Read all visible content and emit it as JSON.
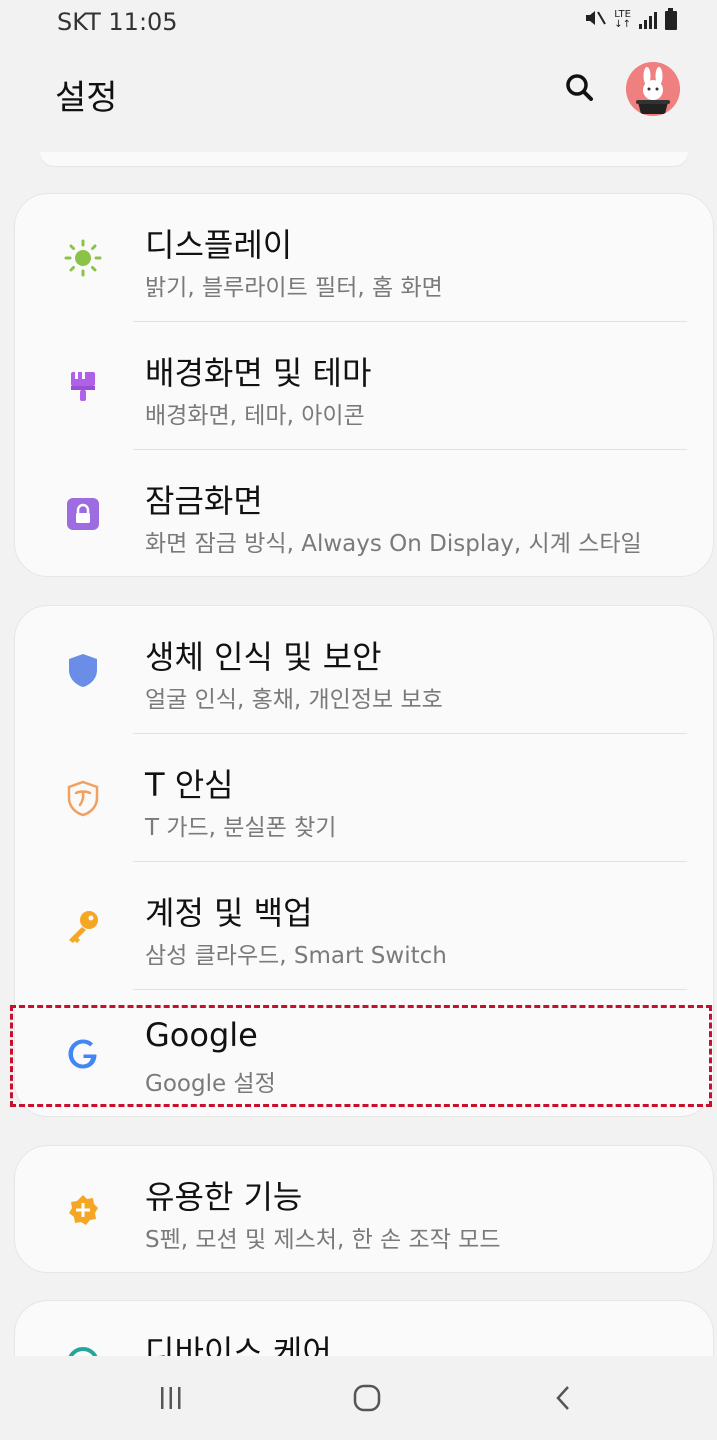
{
  "status_bar": {
    "left_text": "SKT 11:05",
    "network": "LTE",
    "icons": [
      "mute-icon",
      "lte-icon",
      "signal-icon",
      "battery-icon"
    ]
  },
  "header": {
    "title": "설정",
    "icons": [
      "search-icon",
      "avatar"
    ]
  },
  "groups": [
    {
      "items": [
        {
          "title": "디스플레이",
          "subtitle": "밝기, 블루라이트 필터, 홈 화면",
          "icon": "sun-icon",
          "color": "#8bc34a"
        },
        {
          "title": "배경화면 및 테마",
          "subtitle": "배경화면, 테마, 아이콘",
          "icon": "brush-icon",
          "color": "#b061e8"
        },
        {
          "title": "잠금화면",
          "subtitle": "화면 잠금 방식, Always On Display, 시계 스타일",
          "icon": "lock-icon",
          "color": "#9c6ce0"
        }
      ]
    },
    {
      "items": [
        {
          "title": "생체 인식 및 보안",
          "subtitle": "얼굴 인식, 홍채, 개인정보 보호",
          "icon": "shield-icon",
          "color": "#6a8de8"
        },
        {
          "title": "T 안심",
          "subtitle": "T 가드, 분실폰 찾기",
          "icon": "t-guard-icon",
          "color": "#f0a060"
        },
        {
          "title": "계정 및 백업",
          "subtitle": "삼성 클라우드, Smart Switch",
          "icon": "key-icon",
          "color": "#f5a623"
        },
        {
          "title": "Google",
          "subtitle": "Google 설정",
          "icon": "google-icon",
          "color": "#4285f4"
        }
      ]
    },
    {
      "items": [
        {
          "title": "유용한 기능",
          "subtitle": "S펜, 모션 및 제스처, 한 손 조작 모드",
          "icon": "puzzle-icon",
          "color": "#f5a623"
        }
      ]
    },
    {
      "items": [
        {
          "title": "디바이스 케어",
          "icon": "device-care-icon",
          "color": "#26a69a"
        }
      ]
    }
  ],
  "nav_bar": {
    "icons": [
      "recent-apps-icon",
      "home-icon",
      "back-icon"
    ]
  },
  "colors": {
    "background": "#f2f2f2",
    "card": "#fafafa",
    "highlight": "#c8102e"
  }
}
